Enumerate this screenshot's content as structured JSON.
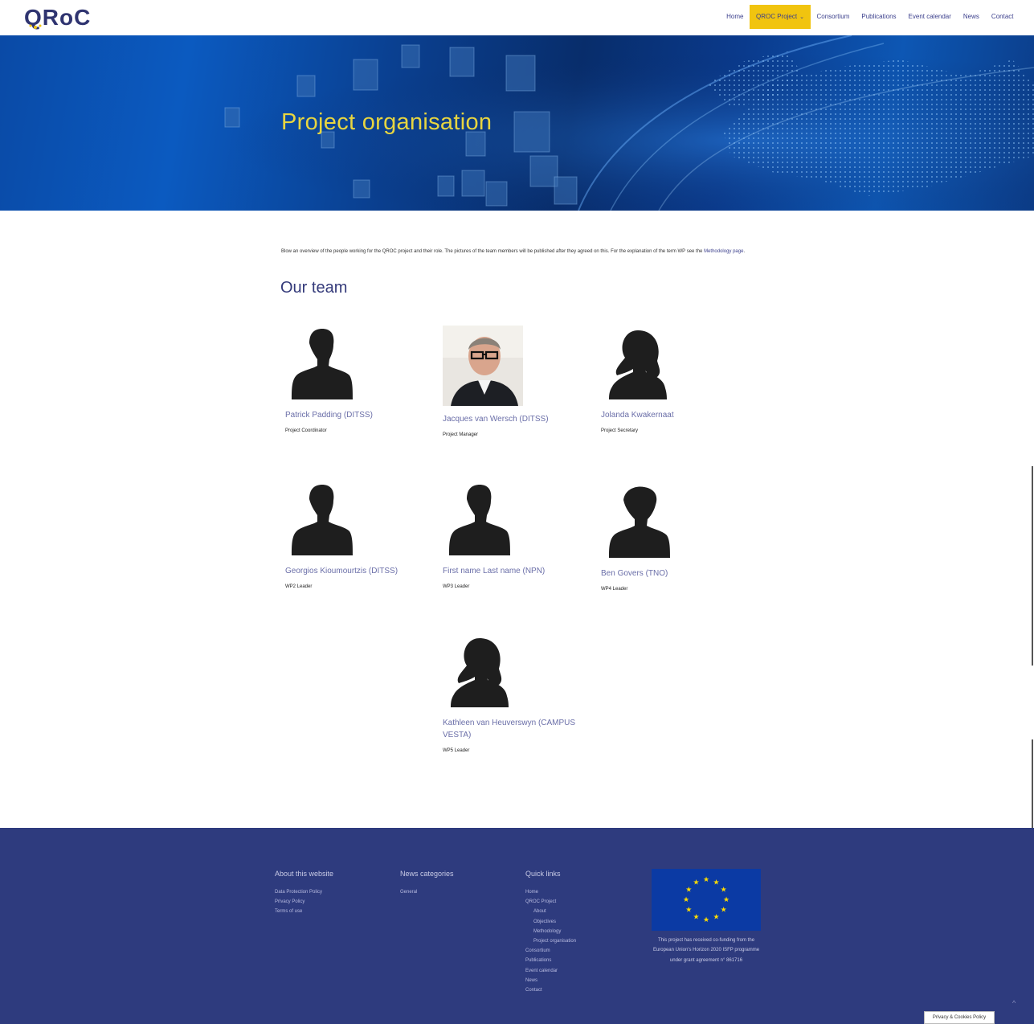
{
  "header": {
    "logo_text": "QRoC",
    "nav": [
      {
        "label": "Home"
      },
      {
        "label": "QROC Project",
        "active": true,
        "caret": "⌄"
      },
      {
        "label": "Consortium"
      },
      {
        "label": "Publications"
      },
      {
        "label": "Event calendar"
      },
      {
        "label": "News"
      },
      {
        "label": "Contact"
      }
    ]
  },
  "hero": {
    "title": "Project organisation"
  },
  "content": {
    "intro_text": "Blow an overview of the people working for the QROC project and their role. The pictures of the team members will be published after they agreed on this. For the explanation of the term WP see the ",
    "intro_link": "Methodology page",
    "intro_end": ".",
    "team_title": "Our team",
    "members": [
      {
        "name": "Patrick Padding (DITSS)",
        "role": "Project Coordinator",
        "avatar": "male-silhouette-icon"
      },
      {
        "name": "Jacques van Wersch (DITSS)",
        "role": "Project Manager",
        "avatar": "photo"
      },
      {
        "name": "Jolanda Kwakernaat",
        "role": "Project Secretary",
        "avatar": "female-silhouette-icon"
      },
      {
        "name": "Georgios Kioumourtzis (DITSS)",
        "role": "WP2 Leader",
        "avatar": "male-silhouette-icon"
      },
      {
        "name": "First name Last name (NPN)",
        "role": "WP3 Leader",
        "avatar": "male-silhouette-icon"
      },
      {
        "name": "Ben Govers (TNO)",
        "role": "WP4 Leader",
        "avatar": "male-silhouette-icon"
      },
      {
        "name": "Kathleen van Heuverswyn (CAMPUS VESTA)",
        "role": "WP5 Leader",
        "avatar": "female-silhouette-icon"
      }
    ]
  },
  "footer": {
    "about": {
      "title": "About this website",
      "links": [
        "Data Protection Policy",
        "Privacy Policy",
        "Terms of use"
      ]
    },
    "news": {
      "title": "News categories",
      "links": [
        "General"
      ]
    },
    "quick": {
      "title": "Quick links",
      "links": [
        {
          "label": "Home",
          "sub": false
        },
        {
          "label": "QROC Project",
          "sub": false
        },
        {
          "label": "About",
          "sub": true
        },
        {
          "label": "Objectives",
          "sub": true
        },
        {
          "label": "Methodology",
          "sub": true
        },
        {
          "label": "Project organisation",
          "sub": true
        },
        {
          "label": "Consortium",
          "sub": false
        },
        {
          "label": "Publications",
          "sub": false
        },
        {
          "label": "Event calendar",
          "sub": false
        },
        {
          "label": "News",
          "sub": false
        },
        {
          "label": "Contact",
          "sub": false
        }
      ]
    },
    "funding_text": "This project has received co-funding from the European Union's Horizon 2020 ISFP programme under grant agreement n° 861716",
    "cookie_label": "Privacy & Cookies Policy",
    "to_top": "^"
  },
  "colors": {
    "accent": "#f1c40f",
    "brand_navy": "#2e3b7e",
    "hero_title": "#e7d540",
    "eu_blue": "#0b3aa4",
    "eu_star": "#ffdd00"
  }
}
